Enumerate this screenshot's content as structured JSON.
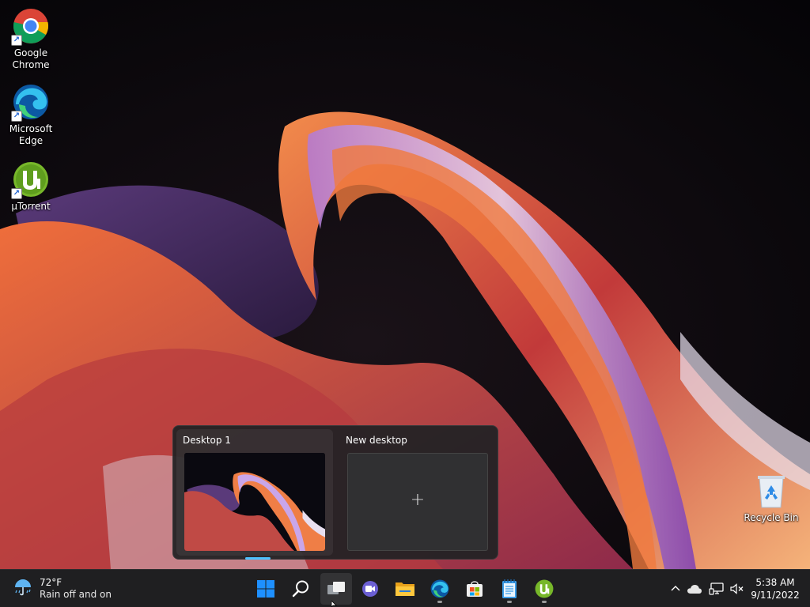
{
  "desktop": {
    "icons": [
      {
        "label_line1": "Google",
        "label_line2": "Chrome",
        "icon": "chrome-icon"
      },
      {
        "label_line1": "Microsoft",
        "label_line2": "Edge",
        "icon": "edge-icon"
      },
      {
        "label_line1": "µTorrent",
        "icon": "utorrent-icon"
      },
      {
        "label_line1": "Recycle Bin",
        "icon": "recycle-bin-icon"
      }
    ]
  },
  "task_view": {
    "desktops": [
      {
        "title": "Desktop 1"
      },
      {
        "title": "New desktop",
        "action_glyph": "+"
      }
    ]
  },
  "taskbar": {
    "weather": {
      "temperature": "72°F",
      "condition": "Rain off and on",
      "icon": "rain-umbrella-icon"
    },
    "pinned": [
      {
        "icon": "start-windows-icon"
      },
      {
        "icon": "search-icon"
      },
      {
        "icon": "task-view-icon",
        "active": true
      },
      {
        "icon": "chat-icon"
      },
      {
        "icon": "file-explorer-icon"
      },
      {
        "icon": "edge-icon",
        "running": true
      },
      {
        "icon": "microsoft-store-icon"
      },
      {
        "icon": "notepad-icon",
        "running": true
      },
      {
        "icon": "utorrent-icon",
        "running": true
      }
    ],
    "tray": {
      "icons": [
        "chevron-up-icon",
        "onedrive-cloud-icon",
        "network-icon",
        "volume-muted-icon"
      ],
      "time": "5:38 AM",
      "date": "9/11/2022"
    }
  },
  "colors": {
    "taskbar_bg": "#1f1f21",
    "accent": "#4cc2ff",
    "windows_blue": "#1e90ff"
  }
}
